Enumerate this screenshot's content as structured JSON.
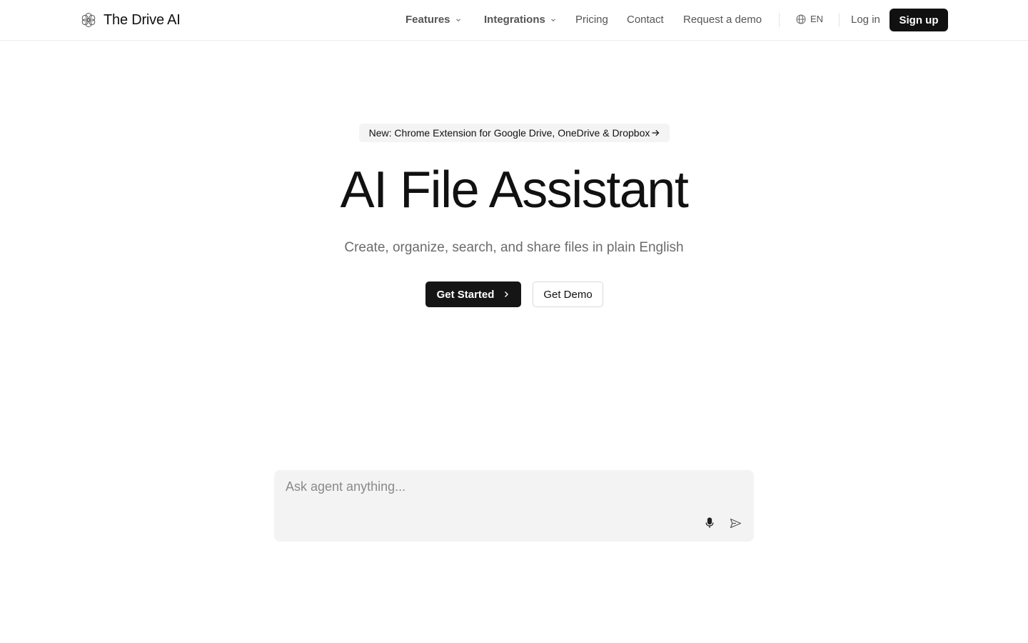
{
  "header": {
    "brand": "The Drive AI",
    "nav": {
      "features": "Features",
      "integrations": "Integrations",
      "pricing": "Pricing",
      "contact": "Contact",
      "request_demo": "Request a demo"
    },
    "language": "EN",
    "login": "Log in",
    "signup": "Sign up"
  },
  "hero": {
    "announcement": "New: Chrome Extension for Google Drive, OneDrive & Dropbox",
    "title": "AI File Assistant",
    "subtitle": "Create, organize, search, and share files in plain English",
    "primary_cta": "Get Started",
    "secondary_cta": "Get Demo"
  },
  "chat": {
    "placeholder": "Ask agent anything..."
  },
  "icons": {
    "logo": "flower-logo-icon",
    "dropdown": "chevron-down-icon",
    "language": "globe-icon",
    "announcement": "arrow-right-icon",
    "cta": "chevron-right-icon",
    "voice": "microphone-icon",
    "send": "send-icon"
  },
  "colors": {
    "primary": "#111111",
    "muted_text": "#555555",
    "subtitle_text": "#6b6b6b",
    "surface": "#f3f3f3",
    "border": "#ececec"
  }
}
